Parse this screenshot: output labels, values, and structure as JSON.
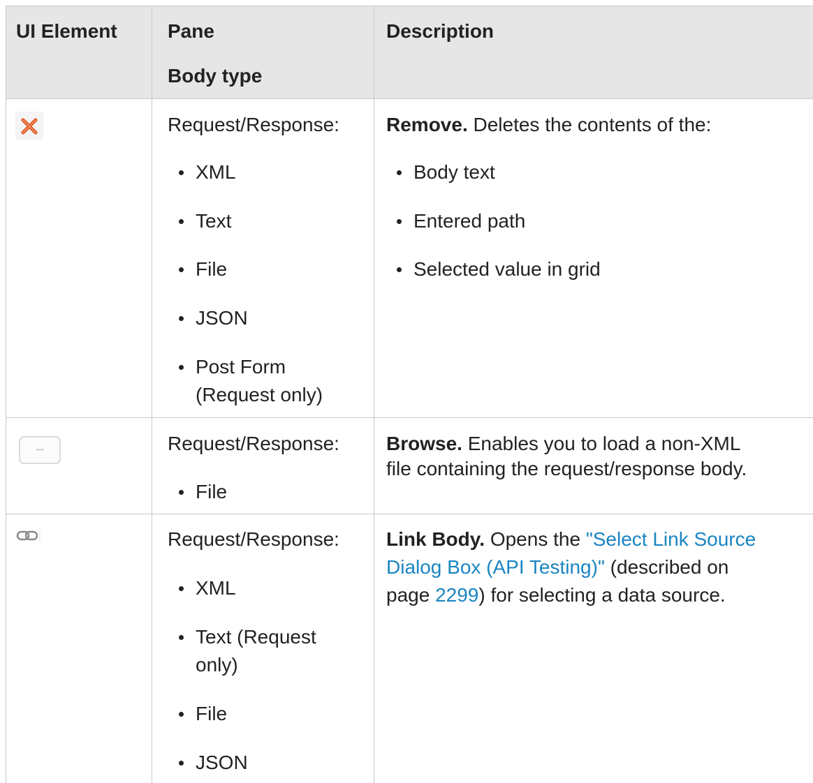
{
  "headers": {
    "col1": "UI Element",
    "col2_line1": "Pane",
    "col2_line2": "Body type",
    "col3": "Description"
  },
  "rows": [
    {
      "icon": "remove-icon",
      "pane": "Request/Response:",
      "bullets": [
        "XML",
        "Text",
        "File",
        "JSON",
        "Post Form",
        "(Request only)"
      ],
      "title": "Remove.",
      "desc": " Deletes the contents of the:",
      "desc_bullets": [
        "Body text",
        "Entered path",
        "Selected value in grid"
      ]
    },
    {
      "icon": "browse-button-icon",
      "icon_label": "...",
      "pane": "Request/Response:",
      "bullets": [
        "File"
      ],
      "title": "Browse.",
      "desc_line1": " Enables you to load a non-XML",
      "desc_line2": "file containing the request/response body."
    },
    {
      "icon": "link-icon",
      "pane": "Request/Response:",
      "bullets": [
        "XML",
        "Text (Request",
        "only)",
        "File",
        "JSON"
      ],
      "title": "Link Body.",
      "desc_pre": " Opens the ",
      "link_line1": "\"Select Link Source",
      "link_line2": "Dialog Box (API Testing)\"",
      "desc_mid": " (described on",
      "desc_page_pre": "page ",
      "page_link": "2299",
      "desc_post": ") for selecting a data source."
    }
  ],
  "colors": {
    "link": "#1a85c2",
    "header_bg": "#e6e6e6",
    "border": "#c8c8c8"
  }
}
